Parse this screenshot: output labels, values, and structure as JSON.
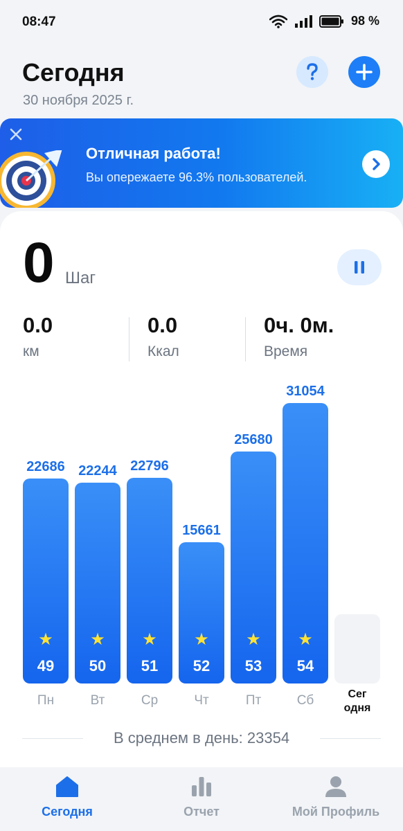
{
  "status_bar": {
    "time": "08:47",
    "battery": "98 %"
  },
  "header": {
    "title": "Сегодня",
    "date": "30 ноября 2025 г."
  },
  "banner": {
    "title": "Отличная работа!",
    "subtitle": "Вы опережаете 96.3% пользователей."
  },
  "steps": {
    "value": "0",
    "label": "Шаг"
  },
  "metrics": [
    {
      "value": "0.0",
      "label": "км"
    },
    {
      "value": "0.0",
      "label": "Ккал"
    },
    {
      "value": "0ч. 0м.",
      "label": "Время"
    }
  ],
  "chart_data": {
    "type": "bar",
    "categories": [
      "Пн",
      "Вт",
      "Ср",
      "Чт",
      "Пт",
      "Сб",
      "Сег одня"
    ],
    "values": [
      22686,
      22244,
      22796,
      15661,
      25680,
      31054,
      0
    ],
    "value_labels": [
      "22686",
      "22244",
      "22796",
      "15661",
      "25680",
      "31054",
      ""
    ],
    "badges": [
      "49",
      "50",
      "51",
      "52",
      "53",
      "54",
      ""
    ],
    "today_label_lines": [
      "Сег",
      "одня"
    ],
    "ylim": [
      0,
      31054
    ],
    "colors": {
      "bar": "#1e74f2",
      "label": "#1c6fe8",
      "star": "#ffe234",
      "empty": "#f1f3f6"
    }
  },
  "average": {
    "text": "В среднем в день: 23354"
  },
  "nav": [
    {
      "label": "Сегодня",
      "icon": "home-icon",
      "active": true
    },
    {
      "label": "Отчет",
      "icon": "bar-chart-icon",
      "active": false
    },
    {
      "label": "Мой Профиль",
      "icon": "profile-icon",
      "active": false
    }
  ]
}
